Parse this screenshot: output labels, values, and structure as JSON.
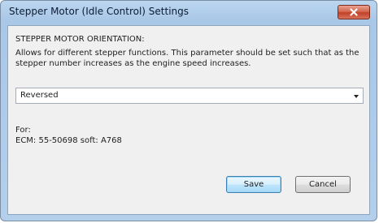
{
  "window": {
    "title": "Stepper Motor (Idle Control) Settings"
  },
  "setting": {
    "heading": "STEPPER MOTOR ORIENTATION:",
    "description": "Allows for different stepper functions. This parameter should be set such that as the stepper number increases as the engine speed increases.",
    "selected_value": "Reversed"
  },
  "info": {
    "for_label": "For:",
    "ecm": "ECM: 55-50698 soft: A768"
  },
  "buttons": {
    "save": "Save",
    "cancel": "Cancel"
  },
  "icons": {
    "close": "close-icon",
    "dropdown": "chevron-down-icon"
  },
  "colors": {
    "close_button": "#c2412a",
    "default_button_border": "#3c7fb1"
  }
}
